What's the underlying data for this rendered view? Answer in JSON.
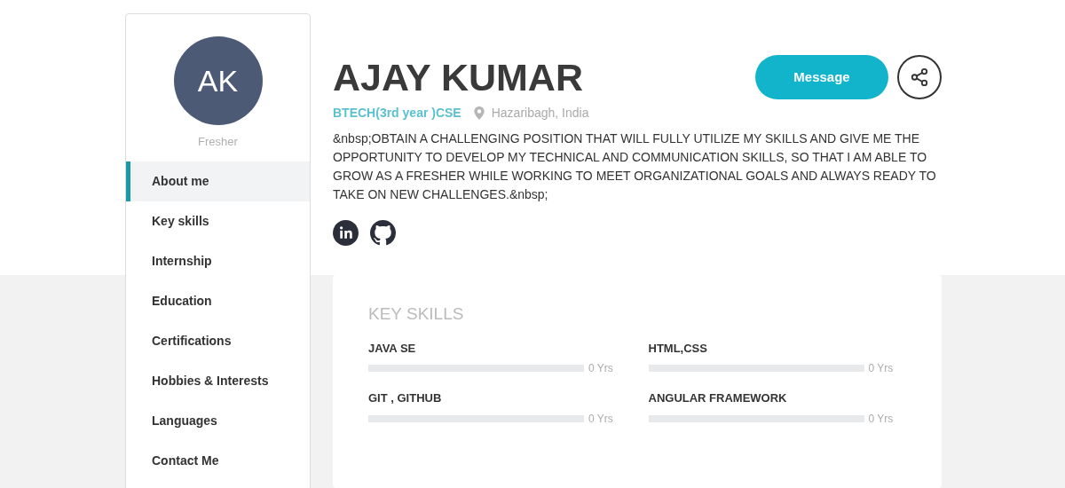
{
  "profile": {
    "initials": "AK",
    "role": "Fresher",
    "name": "AJAY KUMAR",
    "degree": "BTECH(3rd year )CSE",
    "location": "Hazaribagh, India",
    "summary": "&nbsp;OBTAIN A CHALLENGING POSITION THAT WILL FULLY UTILIZE MY SKILLS AND GIVE ME THE OPPORTUNITY TO DEVELOP MY TECHNICAL AND COMMUNICATION SKILLS, SO THAT I AM ABLE TO GROW AS A FRESHER WHILE WORKING TO MEET ORGANIZATIONAL GOALS AND ALWAYS READY TO TAKE ON NEW CHALLENGES.&nbsp;",
    "message_button": "Message"
  },
  "sidebar": {
    "items": [
      {
        "label": "About me",
        "selected": true
      },
      {
        "label": "Key skills",
        "selected": false
      },
      {
        "label": "Internship",
        "selected": false
      },
      {
        "label": "Education",
        "selected": false
      },
      {
        "label": "Certifications",
        "selected": false
      },
      {
        "label": "Hobbies & Interests",
        "selected": false
      },
      {
        "label": "Languages",
        "selected": false
      },
      {
        "label": "Contact Me",
        "selected": false
      }
    ]
  },
  "key_skills": {
    "title": "KEY SKILLS",
    "skills": [
      {
        "name": "JAVA SE",
        "level": 0,
        "reading": "0 Yrs"
      },
      {
        "name": "HTML,CSS",
        "level": 0,
        "reading": "0 Yrs"
      },
      {
        "name": "GIT , GITHUB",
        "level": 0,
        "reading": "0 Yrs"
      },
      {
        "name": "ANGULAR FRAMEWORK",
        "level": 0,
        "reading": "0 Yrs"
      }
    ]
  }
}
